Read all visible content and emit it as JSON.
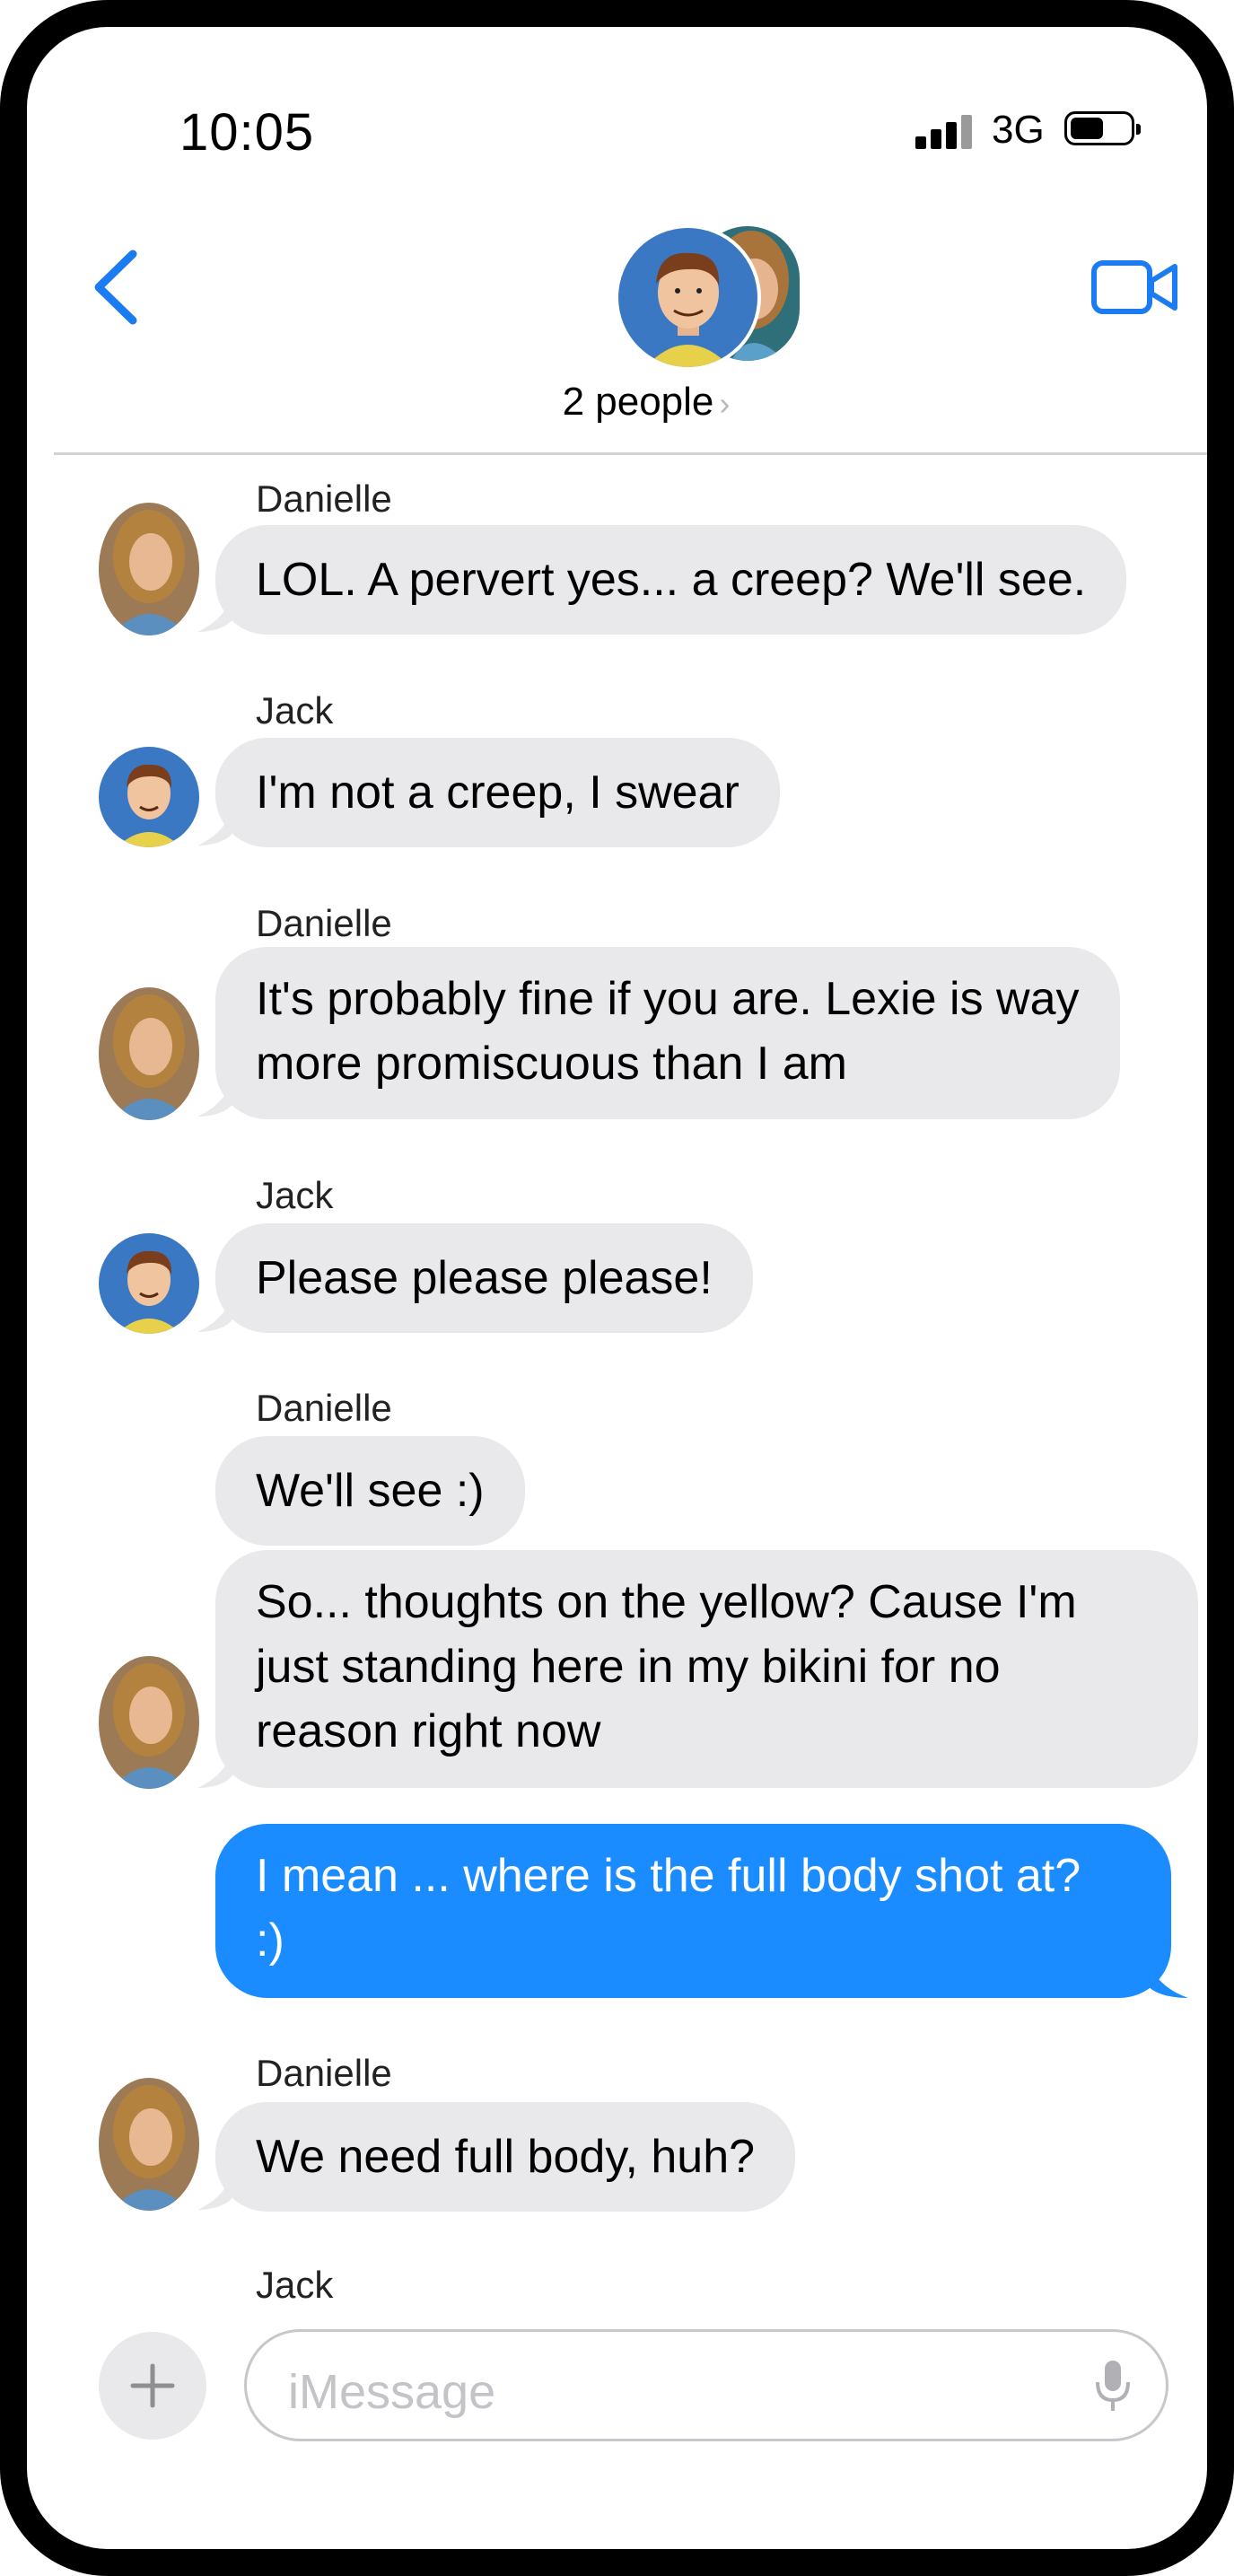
{
  "status": {
    "time": "10:05",
    "network": "3G"
  },
  "header": {
    "people": "2 people"
  },
  "messages": [
    {
      "sender": "Danielle",
      "text": "LOL.  A pervert yes... a creep?  We'll see."
    },
    {
      "sender": "Jack",
      "text": "I'm not a creep, I swear"
    },
    {
      "sender": "Danielle",
      "line1": "It's probably fine if you are.  Lexie is way",
      "line2": "more promiscuous than I am"
    },
    {
      "sender": "Jack",
      "text": "Please please please!"
    },
    {
      "sender": "Danielle",
      "text": "We'll see :)"
    },
    {
      "sender": "",
      "line1": "So... thoughts on the yellow?   Cause I'm",
      "line2": "just standing here in my bikini for no",
      "line3": "reason right now"
    },
    {
      "sender": "",
      "line1": "I mean ... where is the full body shot at?",
      "line2": ":)"
    },
    {
      "sender": "Danielle",
      "text": "We need full body, huh?"
    },
    {
      "sender": "Jack"
    }
  ],
  "composer": {
    "placeholder": "iMessage"
  },
  "icons": {
    "back": "chevron-left-icon",
    "video": "video-camera-icon",
    "add": "plus-icon",
    "mic": "microphone-icon"
  },
  "colors": {
    "accent": "#1a8cff",
    "bubble_gray": "#e9e9eb"
  }
}
